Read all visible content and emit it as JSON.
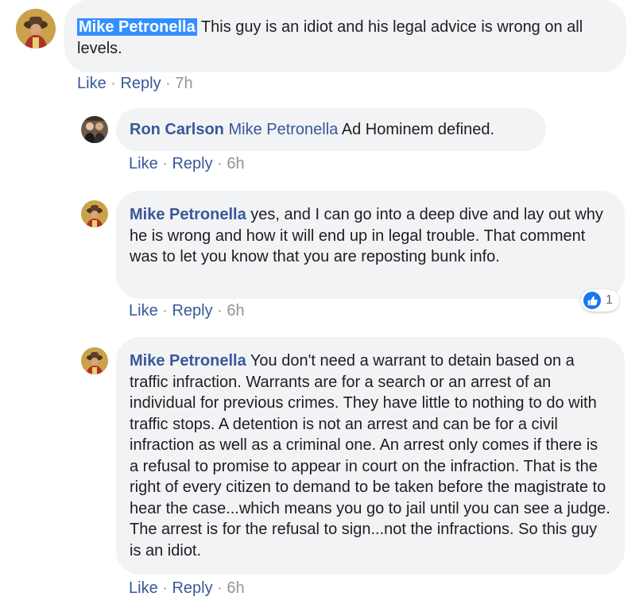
{
  "comments": [
    {
      "author": "Mike Petronella",
      "text": " This guy is an idiot and his legal advice is wrong on all levels.",
      "like": "Like",
      "reply": "Reply",
      "time": "7h"
    },
    {
      "author": "Ron Carlson",
      "mention": "Mike Petronella",
      "text": " Ad Hominem defined.",
      "like": "Like",
      "reply": "Reply",
      "time": "6h"
    },
    {
      "author": "Mike Petronella",
      "text": " yes, and I can go into a deep dive and lay out why he is wrong and how it will end up in legal trouble. That comment was to let you know that you are reposting bunk info.",
      "like": "Like",
      "reply": "Reply",
      "time": "6h",
      "reaction_count": "1"
    },
    {
      "author": "Mike Petronella",
      "text": " You don't need a warrant to detain based on a traffic infraction. Warrants are for a search or an arrest of an individual for previous crimes. They have little to nothing to do with traffic stops. A detention is not an arrest and can be for a civil infraction as well as a criminal one. An arrest only comes if there is a refusal to promise to appear in court on the infraction. That is the right of every citizen to demand to be taken before the magistrate to hear the case...which means you go to jail until you can see a judge. The arrest is for the refusal to sign...not the infractions. So this guy is an idiot.",
      "like": "Like",
      "reply": "Reply",
      "time": "6h"
    }
  ],
  "separator": " · ",
  "colors": {
    "link": "#385898",
    "bubble": "#f2f3f5",
    "meta": "#90949c",
    "highlight": "#3390ff",
    "like_blue": "#1877f2"
  }
}
